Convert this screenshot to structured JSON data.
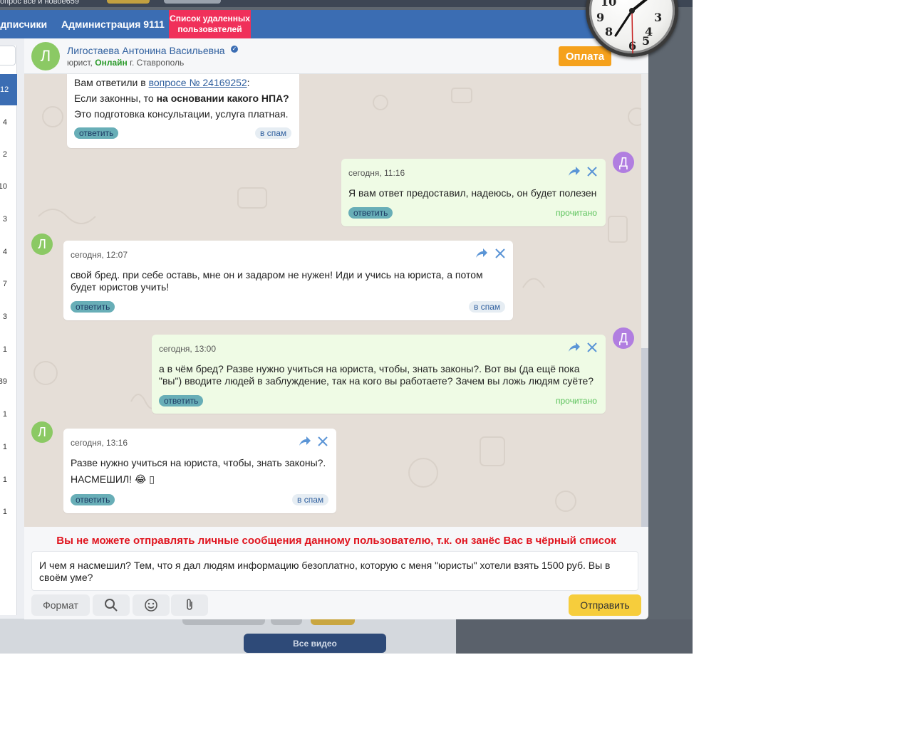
{
  "background": {
    "top_partial_text": "опрос все и новое659",
    "all_videos_label": "Все видео"
  },
  "navbar": {
    "subscribers_label": "одписчики",
    "admin_label": "Администрация 9111",
    "deleted_users_line1": "Список удаленных",
    "deleted_users_line2": "пользователей"
  },
  "sidebar": {
    "counts": [
      "12",
      "4",
      "2",
      "10",
      "3",
      "4",
      "7",
      "3",
      "1",
      "39",
      "1",
      "1",
      "1",
      "1"
    ]
  },
  "header": {
    "avatar_letter": "Л",
    "contact_name": "Лигостаева Антонина Васильевна",
    "role": "юрист,",
    "online_label": "Онлайн",
    "city": "г. Ставрополь",
    "pay_label": "Оплата"
  },
  "messages": [
    {
      "id": "m0",
      "author": "Л",
      "line1_prefix": "Вам ответили в ",
      "line1_link": "вопросе № 24169252",
      "line1_suffix": ":",
      "line2_prefix": "Если законны, то ",
      "line2_bold": "на основании какого НПА?",
      "line3": "Это подготовка консультации, услуга платная.",
      "reply_label": "ответить",
      "spam_label": "в спам"
    },
    {
      "id": "m1",
      "author": "Д",
      "time": "сегодня, 11:16",
      "text": "Я вам ответ предоставил, надеюсь, он будет полезен",
      "reply_label": "ответить",
      "status": "прочитано"
    },
    {
      "id": "m2",
      "author": "Л",
      "time": "сегодня, 12:07",
      "text": "свой бред. при себе оставь, мне он и задаром не нужен! Иди и учись на юриста, а потом будет юристов учить!",
      "reply_label": "ответить",
      "spam_label": "в спам"
    },
    {
      "id": "m3",
      "author": "Д",
      "time": "сегодня, 13:00",
      "text": "а в чём бред? Разве нужно учиться на юриста, чтобы, знать законы?. Вот вы (да ещё пока \"вы\") вводите людей в заблуждение, так на кого вы работаете? Зачем вы ложь людям суёте?",
      "reply_label": "ответить",
      "status": "прочитано"
    },
    {
      "id": "m4",
      "author": "Л",
      "time": "сегодня, 13:16",
      "line1": "Разве нужно учиться на юриста, чтобы, знать законы?.",
      "line2": "НАСМЕШИЛ! 😂 ▯",
      "reply_label": "ответить",
      "spam_label": "в спам"
    }
  ],
  "composer": {
    "warning": "Вы не можете отправлять личные сообщения данному пользователю, т.к. он занёс Вас в чёрный список",
    "input_value": "И чем я насмешил? Тем, что я дал людям информацию безоплатно, которую с меня  \"юристы\" хотели взять 1500 руб. Вы в своём уме?",
    "format_label": "Формат",
    "send_label": "Отправить"
  },
  "icons": {
    "forward": "forward-arrow-icon",
    "close": "close-x-icon",
    "search": "search-icon",
    "emoji": "smiley-icon",
    "attach": "paperclip-icon",
    "verified": "verified-icon",
    "clock": "analog-clock"
  },
  "colors": {
    "navbar": "#3b6db3",
    "deleted_badge": "#f0305a",
    "pay_button": "#f5a11c",
    "send_button": "#f6cd3c",
    "own_bubble": "#effbe5",
    "chat_background": "#e5ded7",
    "warning_text": "#e0141e",
    "online_text": "#2a9a2a"
  }
}
